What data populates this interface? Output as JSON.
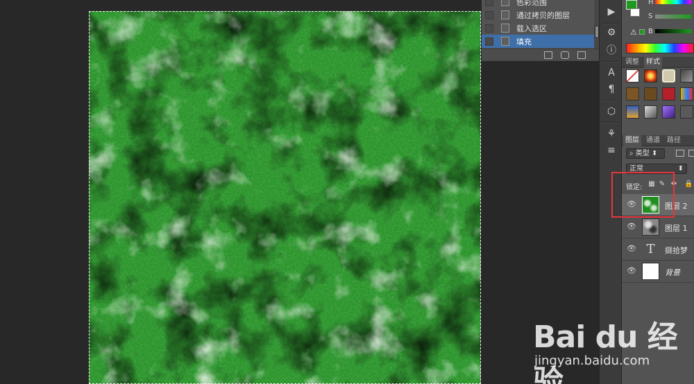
{
  "history": {
    "items": [
      {
        "label": "色彩范围",
        "active": false
      },
      {
        "label": "通过拷贝的图层",
        "active": false
      },
      {
        "label": "载入选区",
        "active": false
      },
      {
        "label": "填充",
        "active": true
      }
    ]
  },
  "color_panel": {
    "h_label": "H",
    "s_label": "S",
    "b_label": "B",
    "fg_color": "#1e9a1e",
    "bg_color": "#ffffff"
  },
  "styles_panel": {
    "tabs": [
      {
        "label": "调整",
        "active": false
      },
      {
        "label": "样式",
        "active": true
      }
    ]
  },
  "layers_panel": {
    "tabs": [
      {
        "label": "图层",
        "active": true
      },
      {
        "label": "通道",
        "active": false
      },
      {
        "label": "路径",
        "active": false
      }
    ],
    "filter_label": "类型",
    "blend_mode": "正常",
    "lock_label": "锁定:",
    "layers": [
      {
        "name": "图层 2",
        "type": "pixel",
        "selected": true,
        "thumb": "green-texture"
      },
      {
        "name": "图层 1",
        "type": "pixel",
        "selected": false,
        "thumb": "gray-texture"
      },
      {
        "name": "撷拾梦",
        "type": "text",
        "selected": false,
        "thumb": "text"
      },
      {
        "name": "背景",
        "type": "background",
        "selected": false,
        "thumb": "white"
      }
    ]
  },
  "icons": {
    "visibility": "eye-icon",
    "text_layer": "T"
  },
  "watermark": {
    "brand": "Bai du 经验",
    "url": "jingyan.baidu.com"
  },
  "colors": {
    "canvas_green": "#1f8f1f",
    "panel_bg": "#535353",
    "selection_highlight": "#3e6fa8",
    "callout_red": "#e8363a"
  }
}
